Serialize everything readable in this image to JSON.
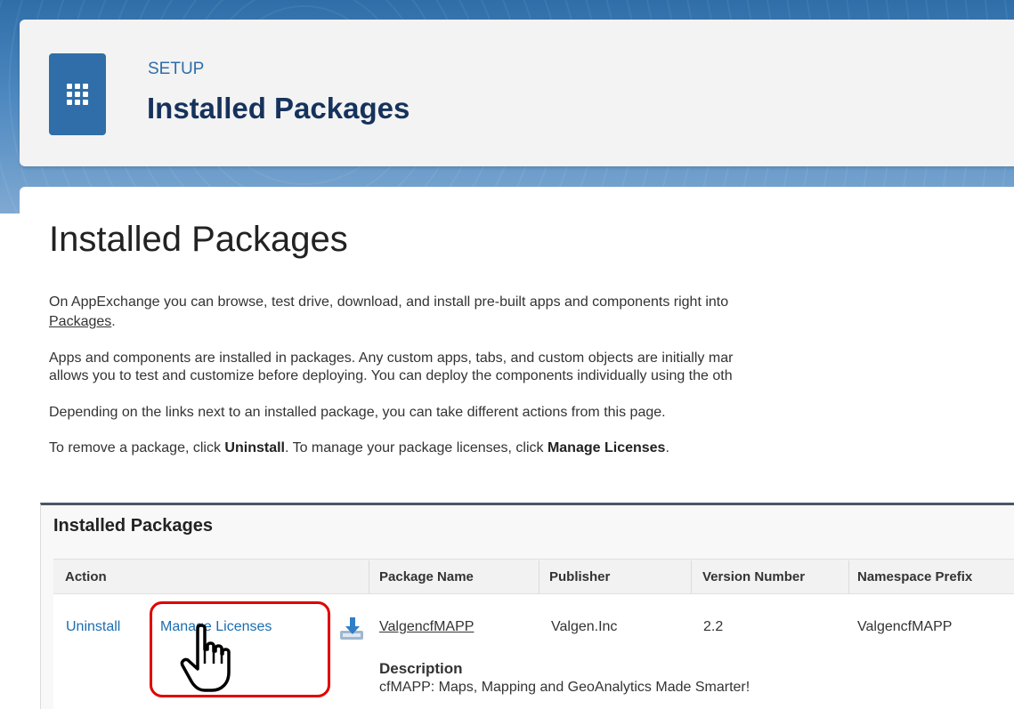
{
  "header": {
    "setup_label": "SETUP",
    "title": "Installed Packages"
  },
  "page": {
    "title": "Installed Packages",
    "intro_line1": "On AppExchange you can browse, test drive, download, and install pre-built apps and components right into",
    "intro_link": "Packages",
    "intro_line1_end": ".",
    "apps_line1": "Apps and components are installed in packages. Any custom apps, tabs, and custom objects are initially mar",
    "apps_line2": "allows you to test and customize before deploying. You can deploy the components individually using the oth",
    "depending": "Depending on the links next to an installed package, you can take different actions from this page.",
    "remove_prefix": "To remove a package, click ",
    "remove_bold1": "Uninstall",
    "remove_middle": ". To manage your package licenses, click ",
    "remove_bold2": "Manage Licenses",
    "remove_suffix": "."
  },
  "panel": {
    "title": "Installed Packages",
    "columns": [
      "Action",
      "Package Name",
      "Publisher",
      "Version Number",
      "Namespace Prefix"
    ],
    "row": {
      "uninstall": "Uninstall",
      "manage_licenses": "Manage Licenses",
      "package_name": "ValgencfMAPP",
      "publisher": "Valgen.Inc",
      "version": "2.2",
      "namespace": "ValgencfMAPP",
      "description_label": "Description",
      "description": "cfMAPP: Maps, Mapping and GeoAnalytics Made Smarter!"
    }
  },
  "colors": {
    "accent": "#2f6ea8",
    "link": "#1b6db1",
    "highlight": "#e00000"
  },
  "icons": [
    "app-launcher-icon",
    "download-icon",
    "hand-cursor-icon"
  ]
}
